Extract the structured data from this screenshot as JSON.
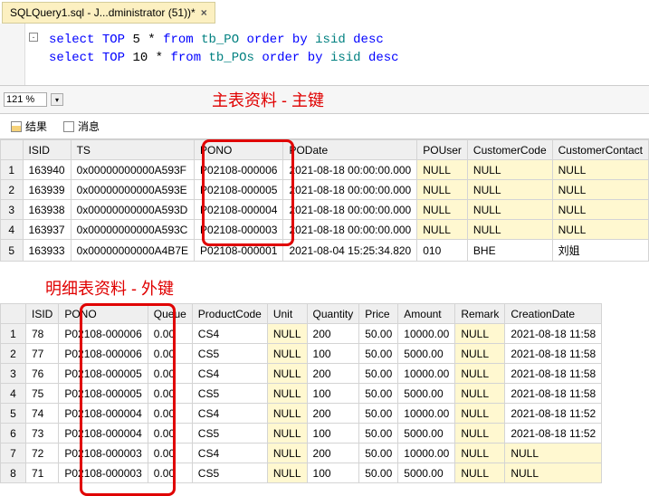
{
  "tab": {
    "title": "SQLQuery1.sql - J...dministrator (51))*",
    "close": "×"
  },
  "code": {
    "line1_select": "select",
    "line1_top": "TOP",
    "line1_num": "5",
    "line1_star": "*",
    "line1_from": "from",
    "line1_table": "tb_PO",
    "line1_orderby": "order by",
    "line1_col": "isid",
    "line1_desc": "desc",
    "line2_select": "select",
    "line2_top": "TOP",
    "line2_num": "10",
    "line2_star": "*",
    "line2_from": "from",
    "line2_table": "tb_POs",
    "line2_orderby": "order by",
    "line2_col": "isid",
    "line2_desc": "desc"
  },
  "zoom": "121 %",
  "annotation1": "主表资料 - 主键",
  "annotation2": "明细表资料 - 外键",
  "results_tab": "结果",
  "messages_tab": "消息",
  "grid1": {
    "headers": [
      "ISID",
      "TS",
      "PONO",
      "PODate",
      "POUser",
      "CustomerCode",
      "CustomerContact"
    ],
    "rows": [
      {
        "n": "1",
        "ISID": "163940",
        "TS": "0x00000000000A593F",
        "PONO": "P02108-000006",
        "PODate": "2021-08-18 00:00:00.000",
        "POUser": "NULL",
        "CustomerCode": "NULL",
        "CustomerContact": "NULL"
      },
      {
        "n": "2",
        "ISID": "163939",
        "TS": "0x00000000000A593E",
        "PONO": "P02108-000005",
        "PODate": "2021-08-18 00:00:00.000",
        "POUser": "NULL",
        "CustomerCode": "NULL",
        "CustomerContact": "NULL"
      },
      {
        "n": "3",
        "ISID": "163938",
        "TS": "0x00000000000A593D",
        "PONO": "P02108-000004",
        "PODate": "2021-08-18 00:00:00.000",
        "POUser": "NULL",
        "CustomerCode": "NULL",
        "CustomerContact": "NULL"
      },
      {
        "n": "4",
        "ISID": "163937",
        "TS": "0x00000000000A593C",
        "PONO": "P02108-000003",
        "PODate": "2021-08-18 00:00:00.000",
        "POUser": "NULL",
        "CustomerCode": "NULL",
        "CustomerContact": "NULL"
      },
      {
        "n": "5",
        "ISID": "163933",
        "TS": "0x00000000000A4B7E",
        "PONO": "P02108-000001",
        "PODate": "2021-08-04 15:25:34.820",
        "POUser": "010",
        "CustomerCode": "BHE",
        "CustomerContact": "刘姐"
      }
    ]
  },
  "grid2": {
    "headers": [
      "ISID",
      "PONO",
      "Queue",
      "ProductCode",
      "Unit",
      "Quantity",
      "Price",
      "Amount",
      "Remark",
      "CreationDate"
    ],
    "rows": [
      {
        "n": "1",
        "ISID": "78",
        "PONO": "P02108-000006",
        "Queue": "0.00",
        "ProductCode": "CS4",
        "Unit": "NULL",
        "Quantity": "200",
        "Price": "50.00",
        "Amount": "10000.00",
        "Remark": "NULL",
        "CreationDate": "2021-08-18 11:58"
      },
      {
        "n": "2",
        "ISID": "77",
        "PONO": "P02108-000006",
        "Queue": "0.00",
        "ProductCode": "CS5",
        "Unit": "NULL",
        "Quantity": "100",
        "Price": "50.00",
        "Amount": "5000.00",
        "Remark": "NULL",
        "CreationDate": "2021-08-18 11:58"
      },
      {
        "n": "3",
        "ISID": "76",
        "PONO": "P02108-000005",
        "Queue": "0.00",
        "ProductCode": "CS4",
        "Unit": "NULL",
        "Quantity": "200",
        "Price": "50.00",
        "Amount": "10000.00",
        "Remark": "NULL",
        "CreationDate": "2021-08-18 11:58"
      },
      {
        "n": "4",
        "ISID": "75",
        "PONO": "P02108-000005",
        "Queue": "0.00",
        "ProductCode": "CS5",
        "Unit": "NULL",
        "Quantity": "100",
        "Price": "50.00",
        "Amount": "5000.00",
        "Remark": "NULL",
        "CreationDate": "2021-08-18 11:58"
      },
      {
        "n": "5",
        "ISID": "74",
        "PONO": "P02108-000004",
        "Queue": "0.00",
        "ProductCode": "CS4",
        "Unit": "NULL",
        "Quantity": "200",
        "Price": "50.00",
        "Amount": "10000.00",
        "Remark": "NULL",
        "CreationDate": "2021-08-18 11:52"
      },
      {
        "n": "6",
        "ISID": "73",
        "PONO": "P02108-000004",
        "Queue": "0.00",
        "ProductCode": "CS5",
        "Unit": "NULL",
        "Quantity": "100",
        "Price": "50.00",
        "Amount": "5000.00",
        "Remark": "NULL",
        "CreationDate": "2021-08-18 11:52"
      },
      {
        "n": "7",
        "ISID": "72",
        "PONO": "P02108-000003",
        "Queue": "0.00",
        "ProductCode": "CS4",
        "Unit": "NULL",
        "Quantity": "200",
        "Price": "50.00",
        "Amount": "10000.00",
        "Remark": "NULL",
        "CreationDate": "NULL"
      },
      {
        "n": "8",
        "ISID": "71",
        "PONO": "P02108-000003",
        "Queue": "0.00",
        "ProductCode": "CS5",
        "Unit": "NULL",
        "Quantity": "100",
        "Price": "50.00",
        "Amount": "5000.00",
        "Remark": "NULL",
        "CreationDate": "NULL"
      }
    ]
  }
}
